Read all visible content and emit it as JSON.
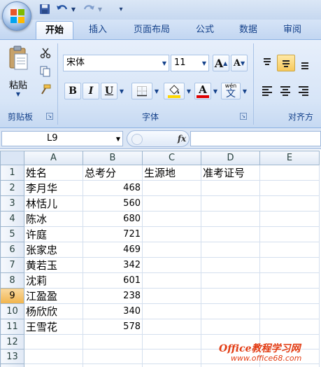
{
  "quick_access": {
    "save_icon": "save-icon",
    "undo_icon": "undo-icon",
    "redo_icon": "redo-icon",
    "customize_icon": "customize-qat-icon"
  },
  "tabs": [
    {
      "label": "开始",
      "active": true
    },
    {
      "label": "插入"
    },
    {
      "label": "页面布局"
    },
    {
      "label": "公式"
    },
    {
      "label": "数据"
    },
    {
      "label": "审阅"
    }
  ],
  "ribbon": {
    "clipboard": {
      "paste_label": "粘贴",
      "group_label": "剪贴板"
    },
    "font": {
      "font_name": "宋体",
      "font_size": "11",
      "group_label": "字体",
      "grow_label": "A",
      "shrink_label": "A",
      "bold": "B",
      "italic": "I",
      "underline": "U",
      "phonetic_top": "wén",
      "phonetic_bottom": "文"
    },
    "alignment": {
      "group_label": "对齐方"
    }
  },
  "formula_bar": {
    "name_box": "L9",
    "fx_label": "fx",
    "formula": ""
  },
  "sheet": {
    "columns": [
      "A",
      "B",
      "C",
      "D",
      "E"
    ],
    "rows": [
      {
        "num": "1",
        "cells": [
          "姓名",
          "总考分",
          "生源地",
          "准考证号",
          ""
        ]
      },
      {
        "num": "2",
        "cells": [
          "李月华",
          "468",
          "",
          "",
          ""
        ]
      },
      {
        "num": "3",
        "cells": [
          "林恬儿",
          "560",
          "",
          "",
          ""
        ]
      },
      {
        "num": "4",
        "cells": [
          "陈冰",
          "680",
          "",
          "",
          ""
        ]
      },
      {
        "num": "5",
        "cells": [
          "许庭",
          "721",
          "",
          "",
          ""
        ]
      },
      {
        "num": "6",
        "cells": [
          "张家忠",
          "469",
          "",
          "",
          ""
        ]
      },
      {
        "num": "7",
        "cells": [
          "黄若玉",
          "342",
          "",
          "",
          ""
        ]
      },
      {
        "num": "8",
        "cells": [
          "沈莉",
          "601",
          "",
          "",
          ""
        ]
      },
      {
        "num": "9",
        "cells": [
          "江盈盈",
          "238",
          "",
          "",
          ""
        ],
        "selected": true
      },
      {
        "num": "10",
        "cells": [
          "杨欣欣",
          "340",
          "",
          "",
          ""
        ]
      },
      {
        "num": "11",
        "cells": [
          "王雪花",
          "578",
          "",
          "",
          ""
        ]
      },
      {
        "num": "12",
        "cells": [
          "",
          "",
          "",
          "",
          ""
        ]
      },
      {
        "num": "13",
        "cells": [
          "",
          "",
          "",
          "",
          ""
        ]
      },
      {
        "num": "14",
        "cells": [
          "",
          "",
          "",
          "",
          ""
        ]
      }
    ]
  },
  "watermark": {
    "line1": "Office教程学习网",
    "line2": "www.office68.com"
  },
  "colors": {
    "accent": "#15428b",
    "ribbon_bg": "#d7e5f7",
    "selected_row": "#f1b44c",
    "highlight": "#ffd700",
    "font_red": "#e00000",
    "watermark": "#e23b12"
  }
}
